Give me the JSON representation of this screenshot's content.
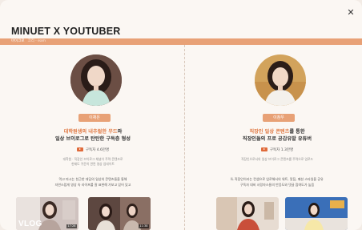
{
  "header": {
    "title": "MINUET X YOUTUBER",
    "bar_label": "마이크로",
    "bar_sub": "크리 · eam"
  },
  "colors": {
    "accent": "#e8a176",
    "highlight": "#e07a45",
    "background": "#fbf7f3"
  },
  "influencers": [
    {
      "name": "이채은",
      "headline_highlight": "대학원생의 내추럴한 무드",
      "headline_suffix": "와",
      "headline_line2": "일상 브이로그로 탄탄한 구독층 형성",
      "subscribers": "구독자 4.6만명",
      "desc_line1": "대학원 · 직장인 브이로그 채널이 주력 콘텐츠로",
      "desc_line2": "현재도 꾸준히 관련 영상 업데이트",
      "note_line1": "먹고 마시는 친근한 대담의 일상의 콘텐츠들을 통해",
      "note_line2": "자연스럽게 영상 속 라이프를 잘 표현해 가보고 있어 있고",
      "thumb1_text": "VLOG",
      "thumb1_duration": "17:26",
      "thumb2_duration": "11:38"
    },
    {
      "name": "이참우",
      "headline_highlight": "직장인 일상 콘텐츠",
      "headline_suffix": "를 통한",
      "headline_line2": "직장인들의 프로 공감유발 유튜버",
      "subscribers": "구독자 1.3만명",
      "desc_line1": "직장인으로서의 일상 브이로그 콘텐츠를 주력으로 업로드",
      "desc_line2": "",
      "note_line1": "IL 직장인이라는 컨셉으로 업로해서의 위트, 맛집, 패션 스타일을 공유",
      "note_line2": "구독자 대비 사랑자스들의 반응도와 댓글 참여도가 높음",
      "thumb1_text": "",
      "thumb1_duration": "",
      "thumb2_duration": ""
    }
  ]
}
